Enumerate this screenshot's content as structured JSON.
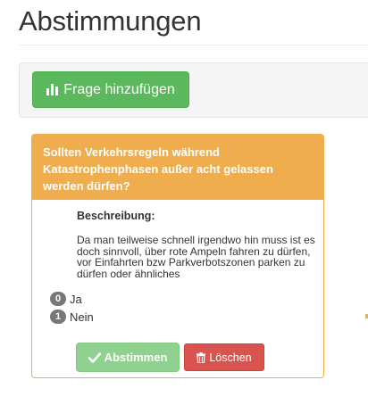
{
  "page": {
    "title": "Abstimmungen"
  },
  "toolbar": {
    "add_question_label": "Frage hinzufügen"
  },
  "poll": {
    "question": "Sollten Verkehrsregeln während Katastrophenphasen außer acht gelassen werden dürfen?",
    "description_label": "Beschreibung:",
    "description": "Da man teilweise schnell irgendwo hin muss ist es doch sinnvoll, über rote Ampeln fahren zu dürfen, vor Einfahrten bzw Parkverbotszonen parken zu dürfen oder ähnliches",
    "options": [
      {
        "count": "0",
        "label": "Ja"
      },
      {
        "count": "1",
        "label": "Nein"
      }
    ],
    "vote_label": "Abstimmen",
    "delete_label": "Löschen"
  },
  "colors": {
    "success": "#5cb85c",
    "success_disabled": "#8fd18f",
    "warning": "#f0ad4e",
    "danger": "#d9534f",
    "badge": "#777777"
  },
  "icons": {
    "add_question": "bar-chart-icon",
    "vote": "checkmark-icon",
    "delete": "trash-icon"
  }
}
